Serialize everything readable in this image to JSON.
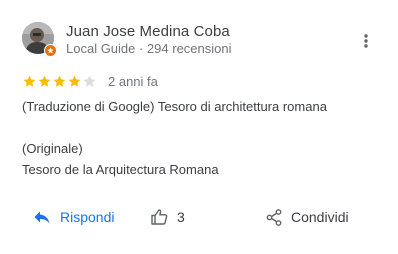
{
  "author": {
    "name": "Juan Jose Medina Coba",
    "meta": "Local Guide · 294 recensioni",
    "badge_color": "#e8710a"
  },
  "rating": {
    "stars": 4,
    "max_stars": 5,
    "filled_color": "#fbbc04",
    "empty_color": "#dadce0"
  },
  "review": {
    "date": "2 anni fa",
    "lines": [
      "(Traduzione di Google) Tesoro di architettura romana",
      "",
      "(Originale)",
      "Tesoro de la Arquitectura Romana"
    ]
  },
  "actions": {
    "reply_label": "Rispondi",
    "like_count": "3",
    "share_label": "Condividi"
  },
  "icons": {
    "more": "more-vert-icon",
    "reply": "reply-icon",
    "like": "thumb-up-icon",
    "share": "share-icon"
  },
  "colors": {
    "accent": "#1a73e8",
    "text": "#3c4043",
    "secondary_text": "#70757a"
  }
}
